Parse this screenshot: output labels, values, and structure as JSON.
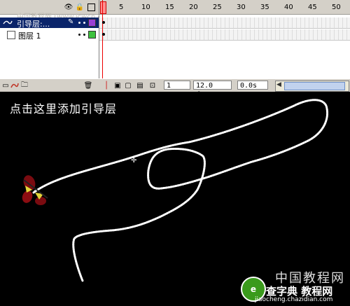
{
  "watermark_top": "中国教程网 (www.jcwcn.com) [design.bbs.com]",
  "timeline": {
    "header_icons": [
      "eye-icon",
      "lock-icon",
      "outline-icon"
    ],
    "frame_ticks": [
      "1",
      "5",
      "10",
      "15",
      "20",
      "25",
      "30",
      "35",
      "40",
      "45",
      "50"
    ],
    "layers": [
      {
        "name": "引导层:...",
        "selected": true,
        "color": "#9a3fd4"
      },
      {
        "name": "图层 1",
        "selected": false,
        "color": "#3ec23e"
      }
    ],
    "current_frame": "1",
    "fps": "12.0 fps",
    "time": "0.0s"
  },
  "stage": {
    "instruction": "点击这里添加引导层",
    "logo_text": "中国教程网",
    "badge_main": "查字典 教程网",
    "badge_url": "jiaocheng.chazidian.com"
  }
}
